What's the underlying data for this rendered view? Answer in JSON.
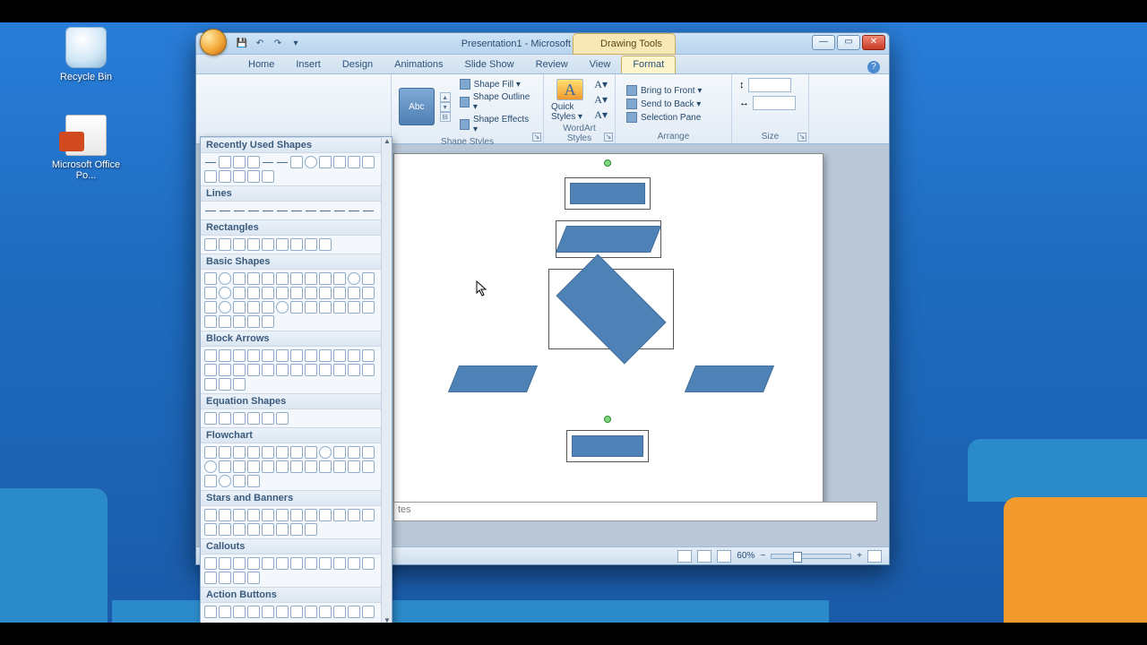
{
  "desktop": {
    "recycle": "Recycle Bin",
    "ppt": "Microsoft Office Po..."
  },
  "title": "Presentation1 - Microsoft PowerPoint",
  "context_tab": "Drawing Tools",
  "tabs": {
    "home": "Home",
    "insert": "Insert",
    "design": "Design",
    "animations": "Animations",
    "slideshow": "Slide Show",
    "review": "Review",
    "view": "View",
    "format": "Format"
  },
  "ribbon": {
    "shape_styles": "Shape Styles",
    "wordart": "WordArt Styles",
    "arrange": "Arrange",
    "size": "Size",
    "abc": "Abc",
    "shape_fill": "Shape Fill ▾",
    "shape_outline": "Shape Outline ▾",
    "shape_effects": "Shape Effects ▾",
    "quick_styles": "Quick Styles ▾",
    "bring_front": "Bring to Front ▾",
    "send_back": "Send to Back ▾",
    "selection_pane": "Selection Pane",
    "size_h": "",
    "size_w": ""
  },
  "gallery": {
    "recent": "Recently Used Shapes",
    "lines": "Lines",
    "rect": "Rectangles",
    "basic": "Basic Shapes",
    "arrows": "Block Arrows",
    "equation": "Equation Shapes",
    "flow": "Flowchart",
    "stars": "Stars and Banners",
    "callouts": "Callouts",
    "action": "Action Buttons"
  },
  "notes_hint": "tes",
  "status": {
    "zoom": "60%"
  }
}
